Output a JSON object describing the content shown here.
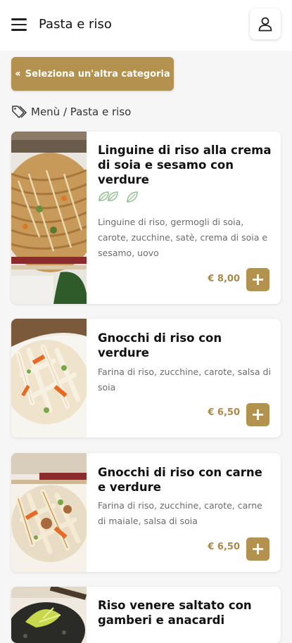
{
  "header": {
    "title": "Pasta e riso",
    "menu_icon": "hamburger-menu-icon",
    "user_icon": "user-icon"
  },
  "back_button": {
    "label": "Seleziona un'altra categoria",
    "icon": "double-chevron-left-icon"
  },
  "breadcrumb": {
    "icon": "tag-icon",
    "text": "Menù / Pasta e riso"
  },
  "colors": {
    "accent": "#b3914e",
    "price": "#a8894a",
    "diet_icon": "#8fc08f"
  },
  "dishes": [
    {
      "name": "Linguine di riso alla crema di soia e sesamo con verdure",
      "badges": [
        "vegetarian-leaves-icon",
        "vegan-leaf-icon"
      ],
      "description": "Linguine di riso, germogli di soia, carote, zucchine, satè, crema di soia e sesamo, uovo",
      "price": "€ 8,00",
      "add_label": "+"
    },
    {
      "name": "Gnocchi di riso con verdure",
      "description": "Farina di riso, zucchine, carote, salsa di soia",
      "price": "€ 6,50",
      "add_label": "+"
    },
    {
      "name": "Gnocchi di riso con carne e verdure",
      "description": "Farina di riso, zucchine, carote, carne di maiale, salsa di soia",
      "price": "€ 6,50",
      "add_label": "+"
    },
    {
      "name": "Riso venere saltato con gamberi e anacardi"
    }
  ]
}
